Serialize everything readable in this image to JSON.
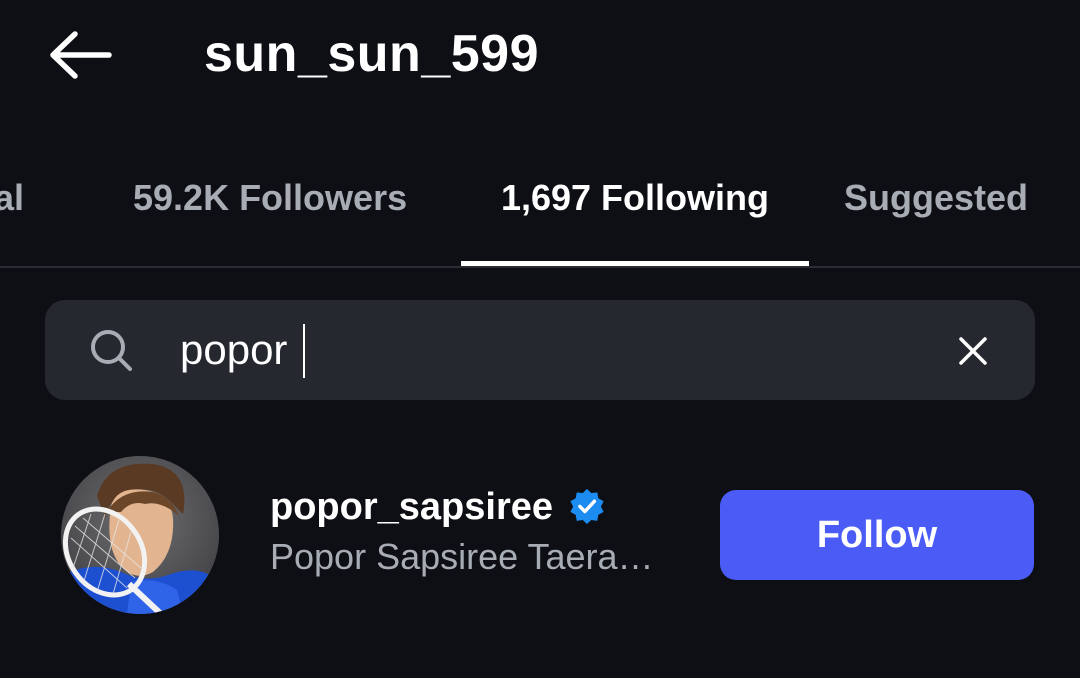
{
  "header": {
    "back_icon": "arrow-left-icon",
    "title": "sun_sun_599"
  },
  "tabs": [
    {
      "label": "Mutual",
      "visible_text": "tual",
      "active": false
    },
    {
      "label": "59.2K Followers",
      "active": false
    },
    {
      "label": "1,697 Following",
      "active": true
    },
    {
      "label": "Suggested",
      "active": false
    }
  ],
  "search": {
    "icon": "search-icon",
    "value": "popor",
    "clear_icon": "close-icon"
  },
  "results": [
    {
      "username": "popor_sapsiree",
      "verified": true,
      "full_name": "Popor Sapsiree Taera…",
      "action_label": "Follow"
    }
  ],
  "colors": {
    "background": "#0d0f14",
    "search_bg": "#25282e",
    "accent": "#4a5cf5",
    "verified": "#1d8cf0",
    "muted_text": "#a8adb5"
  }
}
